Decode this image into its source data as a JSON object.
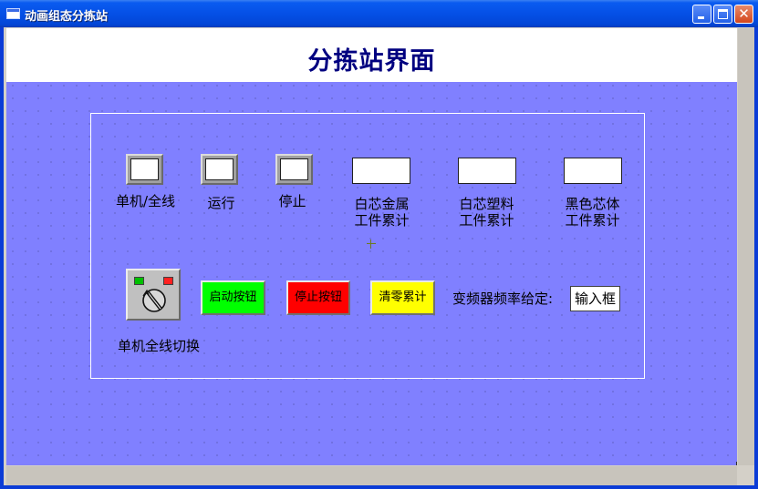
{
  "window": {
    "title": "动画组态分拣站"
  },
  "page": {
    "title": "分拣站界面"
  },
  "indicators": [
    {
      "label": "单机/全线"
    },
    {
      "label": "运行"
    },
    {
      "label": "停止"
    }
  ],
  "counters": [
    {
      "label_line1": "白芯金属",
      "label_line2": "工件累计"
    },
    {
      "label_line1": "白芯塑料",
      "label_line2": "工件累计"
    },
    {
      "label_line1": "黑色芯体",
      "label_line2": "工件累计"
    }
  ],
  "controls": {
    "switch_label": "单机全线切换",
    "start_label": "启动按钮",
    "stop_label": "停止按钮",
    "reset_label": "清零累计",
    "freq_label": "变频器频率给定:",
    "freq_input": "输入框"
  },
  "colors": {
    "canvas": "#8080ff",
    "title": "#000080",
    "start": "#00ff00",
    "stop": "#ff0000",
    "reset": "#ffff00"
  },
  "icons": {
    "switch": "rotary-selector-icon",
    "led_green": "green-led-icon",
    "led_red": "red-led-icon"
  }
}
